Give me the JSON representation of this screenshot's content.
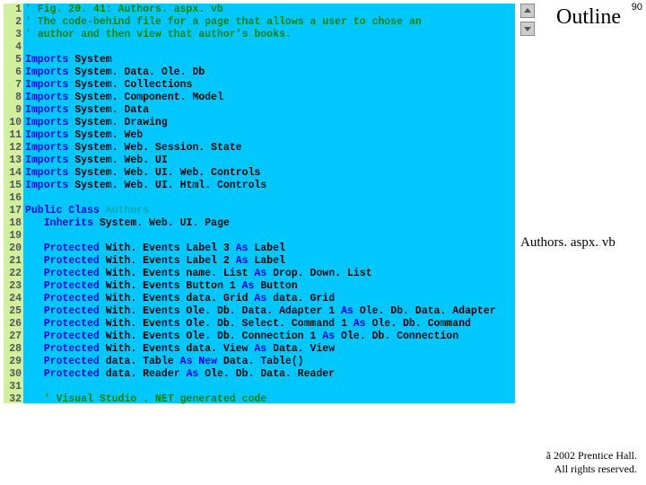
{
  "slide": {
    "number": "90",
    "outline_label": "Outline",
    "caption": "Authors. aspx. vb",
    "copyright1": "ã 2002 Prentice Hall.",
    "copyright2": "All rights reserved."
  },
  "code": {
    "lines": [
      [
        {
          "t": "' Fig. 20. 41: Authors. aspx. vb",
          "c": "c-green"
        }
      ],
      [
        {
          "t": "' The code-behind file for a page that allows a user to chose an",
          "c": "c-green"
        }
      ],
      [
        {
          "t": "' author and then view that author's books.",
          "c": "c-green"
        }
      ],
      [],
      [
        {
          "t": "Imports ",
          "c": "c-blue"
        },
        {
          "t": "System"
        }
      ],
      [
        {
          "t": "Imports ",
          "c": "c-blue"
        },
        {
          "t": "System. Data. Ole. Db"
        }
      ],
      [
        {
          "t": "Imports ",
          "c": "c-blue"
        },
        {
          "t": "System. Collections"
        }
      ],
      [
        {
          "t": "Imports ",
          "c": "c-blue"
        },
        {
          "t": "System. Component. Model"
        }
      ],
      [
        {
          "t": "Imports ",
          "c": "c-blue"
        },
        {
          "t": "System. Data"
        }
      ],
      [
        {
          "t": "Imports ",
          "c": "c-blue"
        },
        {
          "t": "System. Drawing"
        }
      ],
      [
        {
          "t": "Imports ",
          "c": "c-blue"
        },
        {
          "t": "System. Web"
        }
      ],
      [
        {
          "t": "Imports ",
          "c": "c-blue"
        },
        {
          "t": "System. Web. Session. State"
        }
      ],
      [
        {
          "t": "Imports ",
          "c": "c-blue"
        },
        {
          "t": "System. Web. UI"
        }
      ],
      [
        {
          "t": "Imports ",
          "c": "c-blue"
        },
        {
          "t": "System. Web. UI. Web. Controls"
        }
      ],
      [
        {
          "t": "Imports ",
          "c": "c-blue"
        },
        {
          "t": "System. Web. UI. Html. Controls"
        }
      ],
      [],
      [
        {
          "t": "Public Class ",
          "c": "c-blue"
        },
        {
          "t": "Authors",
          "c": "c-cyan"
        }
      ],
      [
        {
          "t": "   Inherits ",
          "c": "c-blue"
        },
        {
          "t": "System. Web. UI. Page"
        }
      ],
      [],
      [
        {
          "t": "   Protected ",
          "c": "c-blue"
        },
        {
          "t": "With. Events Label 3 ",
          "c": ""
        },
        {
          "t": "As ",
          "c": "c-blue"
        },
        {
          "t": "Label"
        }
      ],
      [
        {
          "t": "   Protected ",
          "c": "c-blue"
        },
        {
          "t": "With. Events Label 2 ",
          "c": ""
        },
        {
          "t": "As ",
          "c": "c-blue"
        },
        {
          "t": "Label"
        }
      ],
      [
        {
          "t": "   Protected ",
          "c": "c-blue"
        },
        {
          "t": "With. Events name. List ",
          "c": ""
        },
        {
          "t": "As ",
          "c": "c-blue"
        },
        {
          "t": "Drop. Down. List"
        }
      ],
      [
        {
          "t": "   Protected ",
          "c": "c-blue"
        },
        {
          "t": "With. Events Button 1 ",
          "c": ""
        },
        {
          "t": "As ",
          "c": "c-blue"
        },
        {
          "t": "Button"
        }
      ],
      [
        {
          "t": "   Protected ",
          "c": "c-blue"
        },
        {
          "t": "With. Events data. Grid ",
          "c": ""
        },
        {
          "t": "As ",
          "c": "c-blue"
        },
        {
          "t": "data. Grid"
        }
      ],
      [
        {
          "t": "   Protected ",
          "c": "c-blue"
        },
        {
          "t": "With. Events Ole. Db. Data. Adapter 1 ",
          "c": ""
        },
        {
          "t": "As ",
          "c": "c-blue"
        },
        {
          "t": "Ole. Db. Data. Adapter"
        }
      ],
      [
        {
          "t": "   Protected ",
          "c": "c-blue"
        },
        {
          "t": "With. Events Ole. Db. Select. Command 1 ",
          "c": ""
        },
        {
          "t": "As ",
          "c": "c-blue"
        },
        {
          "t": "Ole. Db. Command"
        }
      ],
      [
        {
          "t": "   Protected ",
          "c": "c-blue"
        },
        {
          "t": "With. Events Ole. Db. Connection 1 ",
          "c": ""
        },
        {
          "t": "As ",
          "c": "c-blue"
        },
        {
          "t": "Ole. Db. Connection"
        }
      ],
      [
        {
          "t": "   Protected ",
          "c": "c-blue"
        },
        {
          "t": "With. Events data. View ",
          "c": ""
        },
        {
          "t": "As ",
          "c": "c-blue"
        },
        {
          "t": "Data. View"
        }
      ],
      [
        {
          "t": "   Protected ",
          "c": "c-blue"
        },
        {
          "t": "data. Table ",
          "c": ""
        },
        {
          "t": "As New ",
          "c": "c-blue"
        },
        {
          "t": "Data. Table()"
        }
      ],
      [
        {
          "t": "   Protected ",
          "c": "c-blue"
        },
        {
          "t": "data. Reader ",
          "c": ""
        },
        {
          "t": "As ",
          "c": "c-blue"
        },
        {
          "t": "Ole. Db. Data. Reader"
        }
      ],
      [],
      [
        {
          "t": "   ' Visual Studio . NET generated code",
          "c": "c-green"
        }
      ]
    ]
  }
}
